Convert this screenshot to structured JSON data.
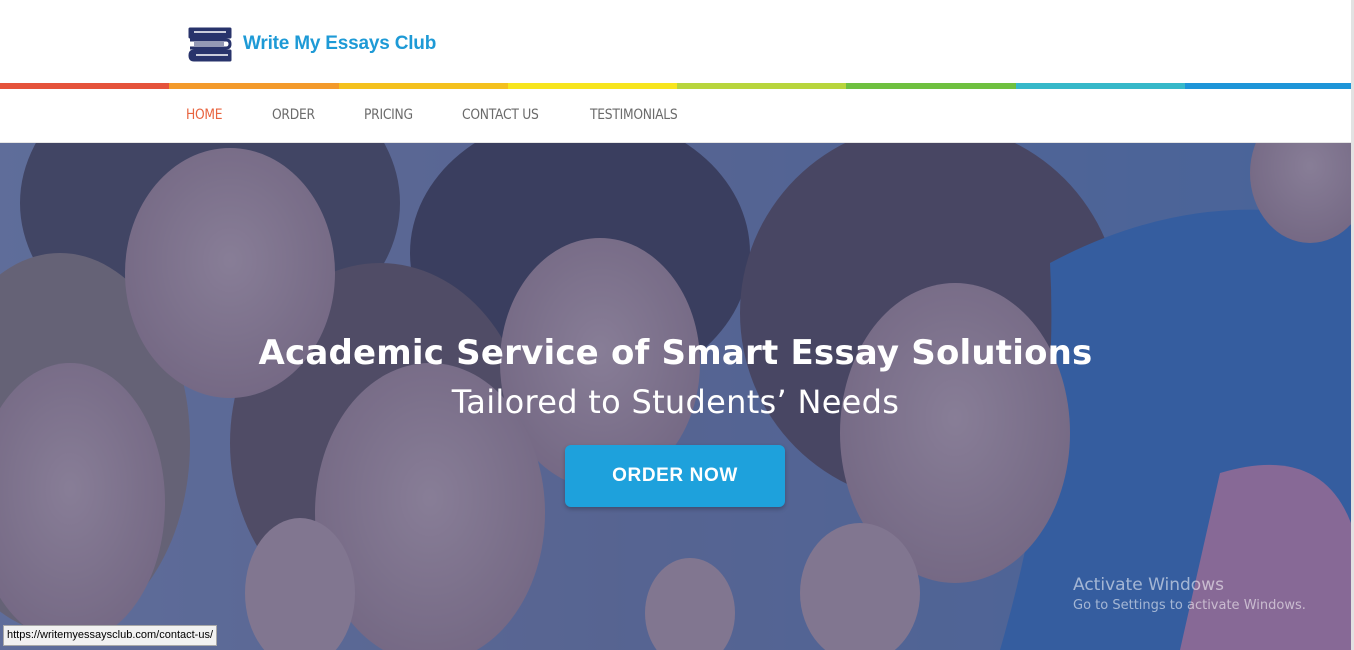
{
  "brand": {
    "name": "Write My Essays Club",
    "color": "#1e9ad6",
    "icon": "books-stack-icon",
    "icon_color": "#28336b"
  },
  "stripe_colors": [
    "#e5533b",
    "#f39a2b",
    "#f4c11e",
    "#f7e51e",
    "#b8d53c",
    "#6fc040",
    "#36b8c9",
    "#1e95d8"
  ],
  "nav": {
    "items": [
      {
        "label": "HOME",
        "active": true
      },
      {
        "label": "ORDER",
        "active": false
      },
      {
        "label": "PRICING",
        "active": false
      },
      {
        "label": "CONTACT US",
        "active": false
      },
      {
        "label": "TESTIMONIALS",
        "active": false
      }
    ],
    "active_color": "#e8643f",
    "color": "#6b6b6b"
  },
  "hero": {
    "title": "Academic Service of Smart Essay Solutions",
    "subtitle": "Tailored to Students’ Needs",
    "cta_label": "ORDER NOW",
    "cta_color": "#1ea1dc",
    "overlay_color": "#3a4f8a"
  },
  "os_watermark": {
    "title": "Activate Windows",
    "subtitle": "Go to Settings to activate Windows."
  },
  "status_bar": {
    "url": "https://writemyessaysclub.com/contact-us/"
  }
}
